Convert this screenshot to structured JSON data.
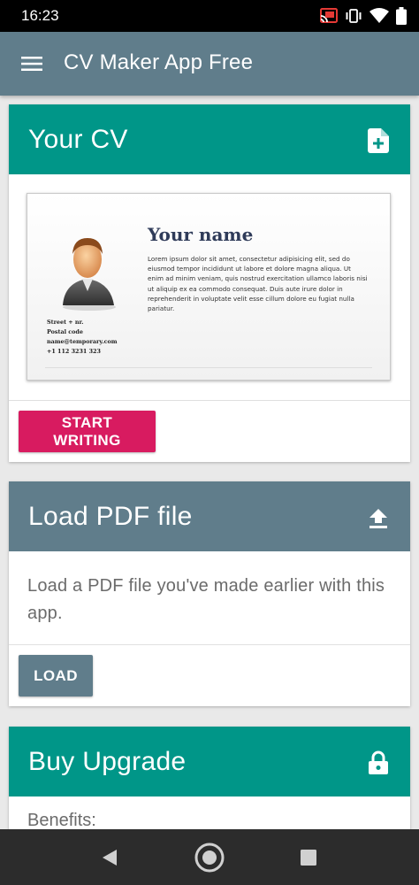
{
  "status_bar": {
    "time": "16:23",
    "icons": [
      "cast-icon",
      "vibrate-icon",
      "wifi-icon",
      "battery-icon"
    ]
  },
  "app_bar": {
    "title": "CV Maker App Free",
    "menu_icon": "menu-icon"
  },
  "cards": {
    "your_cv": {
      "title": "Your CV",
      "icon": "add-document-icon",
      "header_color": "#009688",
      "preview": {
        "name": "Your name",
        "lorem": "Lorem ipsum dolor sit amet, consectetur adipisicing elit, sed do eiusmod tempor incididunt ut labore et dolore magna aliqua. Ut enim ad minim veniam, quis nostrud exercitation ullamco laboris nisi ut aliquip ex ea commodo consequat. Duis aute irure dolor in reprehenderit in voluptate velit esse cillum dolore eu fugiat nulla pariatur.",
        "contact": {
          "street": "Street + nr.",
          "postal": "Postal code",
          "email": "name@temporary.com",
          "phone": "+1 112 3231 323"
        }
      },
      "button": "START WRITING",
      "button_color": "#d81b60"
    },
    "load_pdf": {
      "title": "Load PDF file",
      "icon": "upload-icon",
      "header_color": "#607d8b",
      "description": "Load a PDF file you've made earlier with this app.",
      "button": "LOAD",
      "button_color": "#607d8b"
    },
    "buy_upgrade": {
      "title": "Buy Upgrade",
      "icon": "lock-icon",
      "header_color": "#009688",
      "body_partial": "Benefits:"
    }
  },
  "nav_bar": {
    "buttons": [
      "back-icon",
      "home-icon",
      "recents-icon"
    ]
  }
}
